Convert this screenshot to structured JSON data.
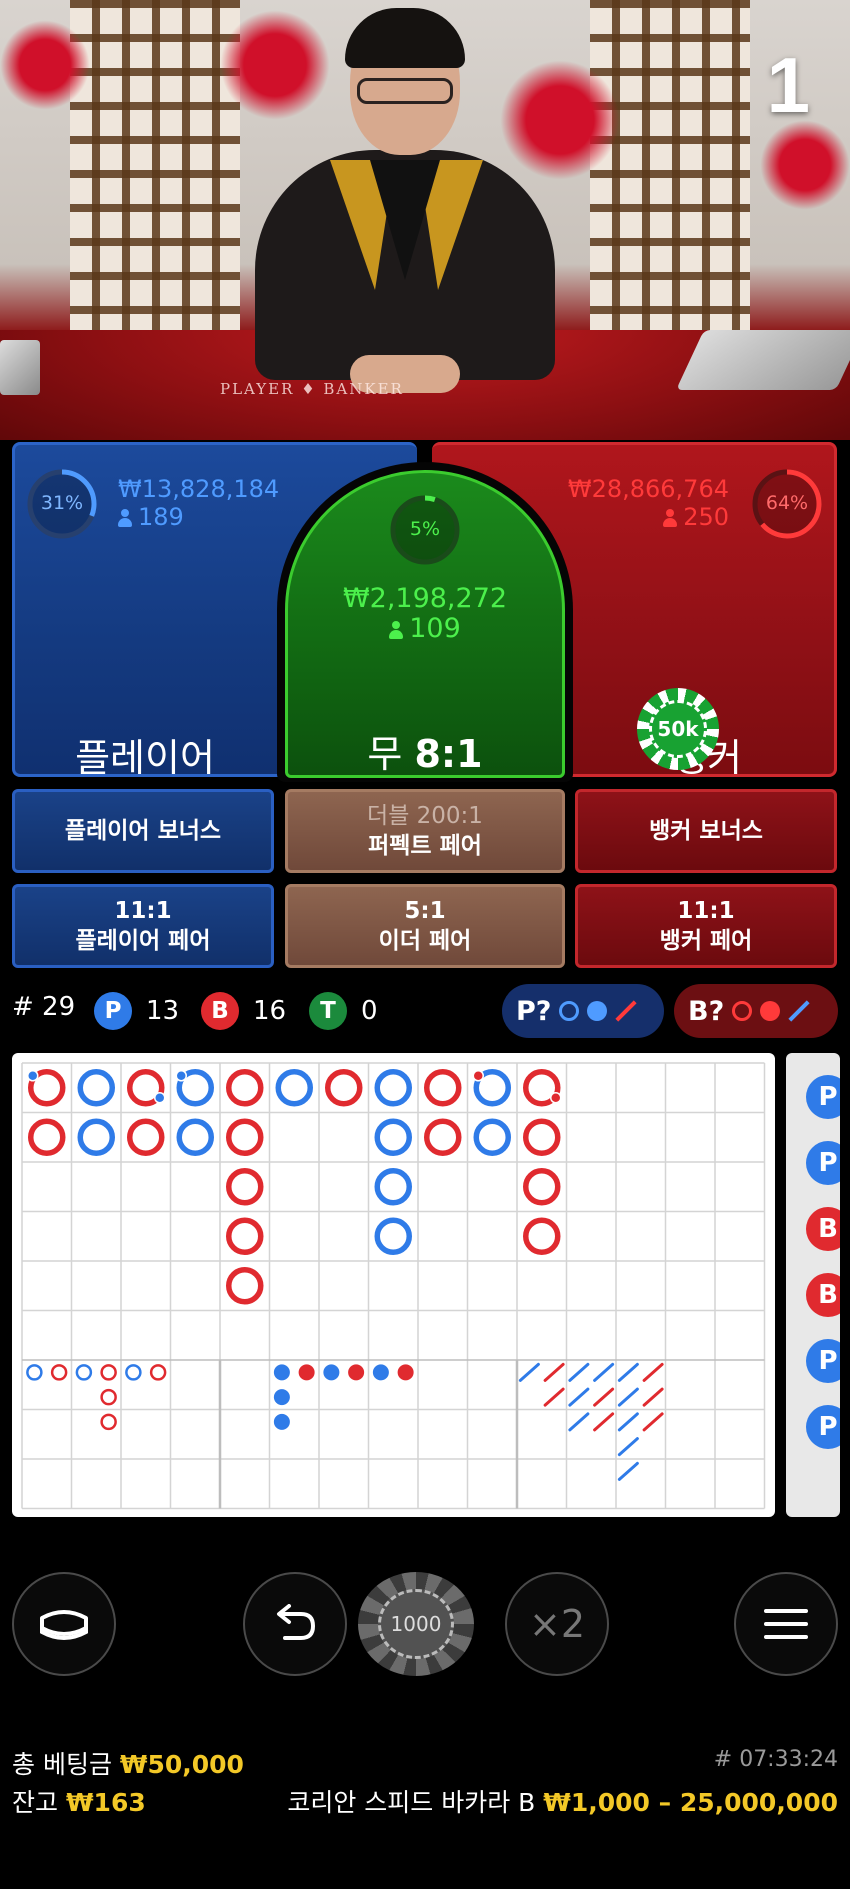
{
  "round_number": "1",
  "video": {
    "table_text": "PLAYER ♦ BANKER"
  },
  "player": {
    "percent": "31%",
    "percent_value": 31,
    "amount": "₩13,828,184",
    "players": "189",
    "label": "플레이어"
  },
  "tie": {
    "percent": "5%",
    "percent_value": 5,
    "amount": "₩2,198,272",
    "players": "109",
    "label": "무",
    "odds": "8:1"
  },
  "banker": {
    "percent": "64%",
    "percent_value": 64,
    "amount": "₩28,866,764",
    "players": "250",
    "label": "뱅커"
  },
  "placed_chip": {
    "label": "50k",
    "on": "banker"
  },
  "side_bets": {
    "player_bonus": "플레이어 보너스",
    "perfect_pair_odds": "더블 200:1",
    "perfect_pair": "퍼펙트 페어",
    "banker_bonus": "뱅커 보너스",
    "player_pair_odds": "11:1",
    "player_pair": "플레이어 페어",
    "either_pair_odds": "5:1",
    "either_pair": "이더 페어",
    "banker_pair_odds": "11:1",
    "banker_pair": "뱅커 페어"
  },
  "stats": {
    "round_prefix": "# 29",
    "p_badge": "P",
    "p_count": "13",
    "b_badge": "B",
    "b_count": "16",
    "t_badge": "T",
    "t_count": "0",
    "p_predict": "P?",
    "b_predict": "B?"
  },
  "roads": {
    "big_road": [
      {
        "col": 0,
        "row": 0,
        "c": "red",
        "pair": "blue"
      },
      {
        "col": 0,
        "row": 1,
        "c": "red"
      },
      {
        "col": 1,
        "row": 0,
        "c": "blue"
      },
      {
        "col": 1,
        "row": 1,
        "c": "blue"
      },
      {
        "col": 2,
        "row": 0,
        "c": "red",
        "pair": "blue-br"
      },
      {
        "col": 2,
        "row": 1,
        "c": "red"
      },
      {
        "col": 3,
        "row": 0,
        "c": "blue",
        "pair": "blue"
      },
      {
        "col": 3,
        "row": 1,
        "c": "blue"
      },
      {
        "col": 4,
        "row": 0,
        "c": "red"
      },
      {
        "col": 4,
        "row": 1,
        "c": "red"
      },
      {
        "col": 4,
        "row": 2,
        "c": "red"
      },
      {
        "col": 4,
        "row": 3,
        "c": "red"
      },
      {
        "col": 4,
        "row": 4,
        "c": "red"
      },
      {
        "col": 5,
        "row": 0,
        "c": "blue"
      },
      {
        "col": 6,
        "row": 0,
        "c": "red"
      },
      {
        "col": 7,
        "row": 0,
        "c": "blue"
      },
      {
        "col": 7,
        "row": 1,
        "c": "blue"
      },
      {
        "col": 7,
        "row": 2,
        "c": "blue"
      },
      {
        "col": 7,
        "row": 3,
        "c": "blue"
      },
      {
        "col": 8,
        "row": 0,
        "c": "red"
      },
      {
        "col": 8,
        "row": 1,
        "c": "red"
      },
      {
        "col": 9,
        "row": 0,
        "c": "blue",
        "pair": "red"
      },
      {
        "col": 9,
        "row": 1,
        "c": "blue"
      },
      {
        "col": 10,
        "row": 0,
        "c": "red",
        "pair": "red-br"
      },
      {
        "col": 10,
        "row": 1,
        "c": "red"
      },
      {
        "col": 10,
        "row": 2,
        "c": "red"
      },
      {
        "col": 10,
        "row": 3,
        "c": "red"
      }
    ],
    "big_eye": [
      {
        "col": 0,
        "row": 0,
        "c": "blue"
      },
      {
        "col": 1,
        "row": 0,
        "c": "red"
      },
      {
        "col": 2,
        "row": 0,
        "c": "blue"
      },
      {
        "col": 3,
        "row": 0,
        "c": "red"
      },
      {
        "col": 3,
        "row": 1,
        "c": "red"
      },
      {
        "col": 3,
        "row": 2,
        "c": "red"
      },
      {
        "col": 4,
        "row": 0,
        "c": "blue"
      },
      {
        "col": 5,
        "row": 0,
        "c": "red"
      }
    ],
    "small_road": [
      {
        "col": 0,
        "row": 0,
        "c": "blue"
      },
      {
        "col": 0,
        "row": 1,
        "c": "blue"
      },
      {
        "col": 0,
        "row": 2,
        "c": "blue"
      },
      {
        "col": 1,
        "row": 0,
        "c": "red"
      },
      {
        "col": 2,
        "row": 0,
        "c": "blue"
      },
      {
        "col": 3,
        "row": 0,
        "c": "red"
      },
      {
        "col": 4,
        "row": 0,
        "c": "blue"
      },
      {
        "col": 5,
        "row": 0,
        "c": "red"
      }
    ],
    "cockroach": [
      {
        "col": 0,
        "row": 0,
        "c": "blue"
      },
      {
        "col": 1,
        "row": 0,
        "c": "red"
      },
      {
        "col": 1,
        "row": 1,
        "c": "red"
      },
      {
        "col": 2,
        "row": 0,
        "c": "blue"
      },
      {
        "col": 2,
        "row": 1,
        "c": "blue"
      },
      {
        "col": 2,
        "row": 2,
        "c": "blue"
      },
      {
        "col": 3,
        "row": 0,
        "c": "blue"
      },
      {
        "col": 3,
        "row": 1,
        "c": "red"
      },
      {
        "col": 3,
        "row": 2,
        "c": "red"
      },
      {
        "col": 4,
        "row": 0,
        "c": "blue"
      },
      {
        "col": 4,
        "row": 1,
        "c": "blue"
      },
      {
        "col": 4,
        "row": 2,
        "c": "blue"
      },
      {
        "col": 4,
        "row": 3,
        "c": "blue"
      },
      {
        "col": 4,
        "row": 4,
        "c": "blue"
      },
      {
        "col": 5,
        "row": 0,
        "c": "red"
      },
      {
        "col": 5,
        "row": 1,
        "c": "red"
      },
      {
        "col": 5,
        "row": 2,
        "c": "red"
      }
    ],
    "bead_plate": [
      "P",
      "P",
      "B",
      "B",
      "P",
      "P"
    ]
  },
  "controls": {
    "chip_value": "1000",
    "double_label": "×2"
  },
  "footer": {
    "total_bet_label": "총 베팅금",
    "total_bet": "₩50,000",
    "balance_label": "잔고",
    "balance": "₩163",
    "game_id": "# 07:33:24",
    "table_name": "코리안 스피드 바카라 B",
    "limits": "₩1,000 – 25,000,000"
  },
  "colors": {
    "player_blue": "#2f7be8",
    "banker_red": "#e02a2f",
    "tie_green": "#3bd34a",
    "gold": "#f3c827"
  }
}
